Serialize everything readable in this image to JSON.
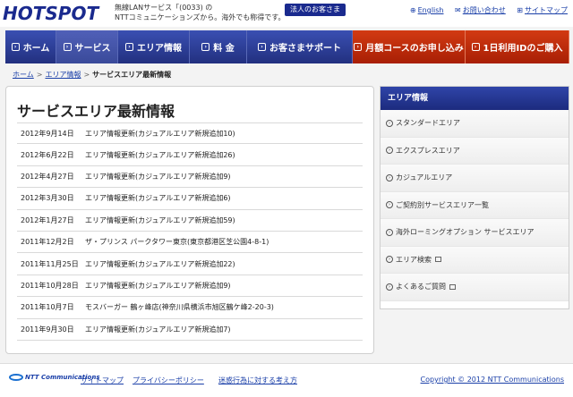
{
  "header": {
    "logo_text": "HOTSPOT",
    "tagline_1": "無線LANサービス「(0033) の",
    "tagline_2": "NTTコミュニケーションズから。海外でも称得です。",
    "corp_button": "法人のお客さま",
    "links": [
      "English",
      "お問い合わせ",
      "サイトマップ"
    ]
  },
  "nav": {
    "items": [
      "ホーム",
      "サービス",
      "エリア情報",
      "料 金",
      "お客さまサポート",
      "月額コースのお申し込み",
      "1日利用IDのご購入"
    ]
  },
  "breadcrumb": {
    "home": "ホーム",
    "area": "エリア情報",
    "current": "サービスエリア最新情報"
  },
  "main": {
    "title": "サービスエリア最新情報",
    "news": [
      {
        "date": "2012年9月14日",
        "text": "エリア情報更新(カジュアルエリア新規追加10)"
      },
      {
        "date": "2012年6月22日",
        "text": "エリア情報更新(カジュアルエリア新規追加26)"
      },
      {
        "date": "2012年4月27日",
        "text": "エリア情報更新(カジュアルエリア新規追加9)"
      },
      {
        "date": "2012年3月30日",
        "text": "エリア情報更新(カジュアルエリア新規追加6)"
      },
      {
        "date": "2012年1月27日",
        "text": "エリア情報更新(カジュアルエリア新規追加59)"
      },
      {
        "date": "2011年12月2日",
        "text": "ザ・プリンス パークタワー東京(東京都港区芝公園4-8-1)"
      },
      {
        "date": "2011年11月25日",
        "text": "エリア情報更新(カジュアルエリア新規追加22)"
      },
      {
        "date": "2011年10月28日",
        "text": "エリア情報更新(カジュアルエリア新規追加9)"
      },
      {
        "date": "2011年10月7日",
        "text": "モスバーガー 鶴ヶ峰店(神奈川県横浜市旭区鶴ケ峰2-20-3)"
      },
      {
        "date": "2011年9月30日",
        "text": "エリア情報更新(カジュアルエリア新規追加7)"
      }
    ]
  },
  "sidebar": {
    "heading": "エリア情報",
    "items": [
      "スタンダードエリア",
      "エクスプレスエリア",
      "カジュアルエリア",
      "ご契約別サービスエリア一覧",
      "海外ローミングオプション サービスエリア",
      "エリア検索",
      "よくあるご質問"
    ]
  },
  "footer": {
    "ntt_logo": "NTT Communications",
    "links": [
      "サイトマップ",
      "プライバシーポリシー",
      "迷惑行為に対する考え方"
    ],
    "copyright": "Copyright © 2012 NTT Communications"
  }
}
